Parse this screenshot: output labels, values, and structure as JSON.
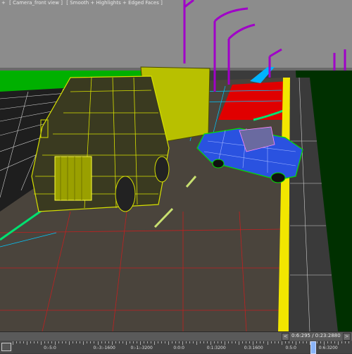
{
  "viewport": {
    "label_parts": [
      "+",
      "[ Camera_front view ]",
      "[ Smooth + Highlights + Edged Faces ]"
    ],
    "colors": {
      "sky": "#8c8c8c",
      "grass": "#00b400",
      "road": "#4a443c",
      "truck_wire": "#d6e000",
      "car_wire": "#2255ff",
      "lamp_posts": "#a000c8",
      "road_marking": "#f2e600",
      "red_zone": "#e00000"
    }
  },
  "timeline": {
    "nav_prev": "<",
    "nav_next": ">",
    "frame_readout": "0:6:295 / 0:23:2880",
    "tick_labels": [
      "0:-5:0",
      "0:-3:-1600",
      "0:-1:-3200",
      "0:0:0",
      "0:1:3200",
      "0:3:1600",
      "0:5:0",
      "0:6:3200"
    ],
    "tick_label_fraction": [
      0.11,
      0.27,
      0.38,
      0.49,
      0.6,
      0.71,
      0.82,
      0.93
    ]
  }
}
